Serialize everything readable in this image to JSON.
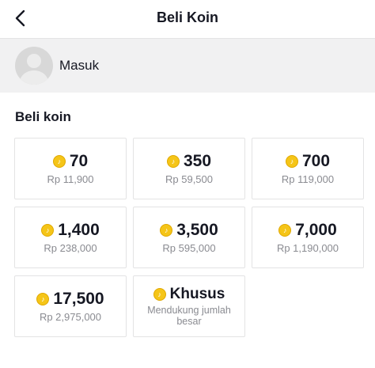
{
  "header": {
    "title": "Beli Koin",
    "back_icon": "chevron-left-icon"
  },
  "login": {
    "label": "Masuk",
    "avatar_icon": "default-avatar-icon"
  },
  "section_title": "Beli koin",
  "colors": {
    "coin": "#f5c518",
    "text": "#161823",
    "muted": "#8a8b91",
    "border": "#e3e3e4",
    "login_bg": "#f1f1f2"
  },
  "packages": [
    {
      "coins": "70",
      "price": "Rp 11,900"
    },
    {
      "coins": "350",
      "price": "Rp 59,500"
    },
    {
      "coins": "700",
      "price": "Rp 119,000"
    },
    {
      "coins": "1,400",
      "price": "Rp 238,000"
    },
    {
      "coins": "3,500",
      "price": "Rp 595,000"
    },
    {
      "coins": "7,000",
      "price": "Rp 1,190,000"
    },
    {
      "coins": "17,500",
      "price": "Rp 2,975,000"
    }
  ],
  "special": {
    "label": "Khusus",
    "description": "Mendukung jumlah besar"
  }
}
